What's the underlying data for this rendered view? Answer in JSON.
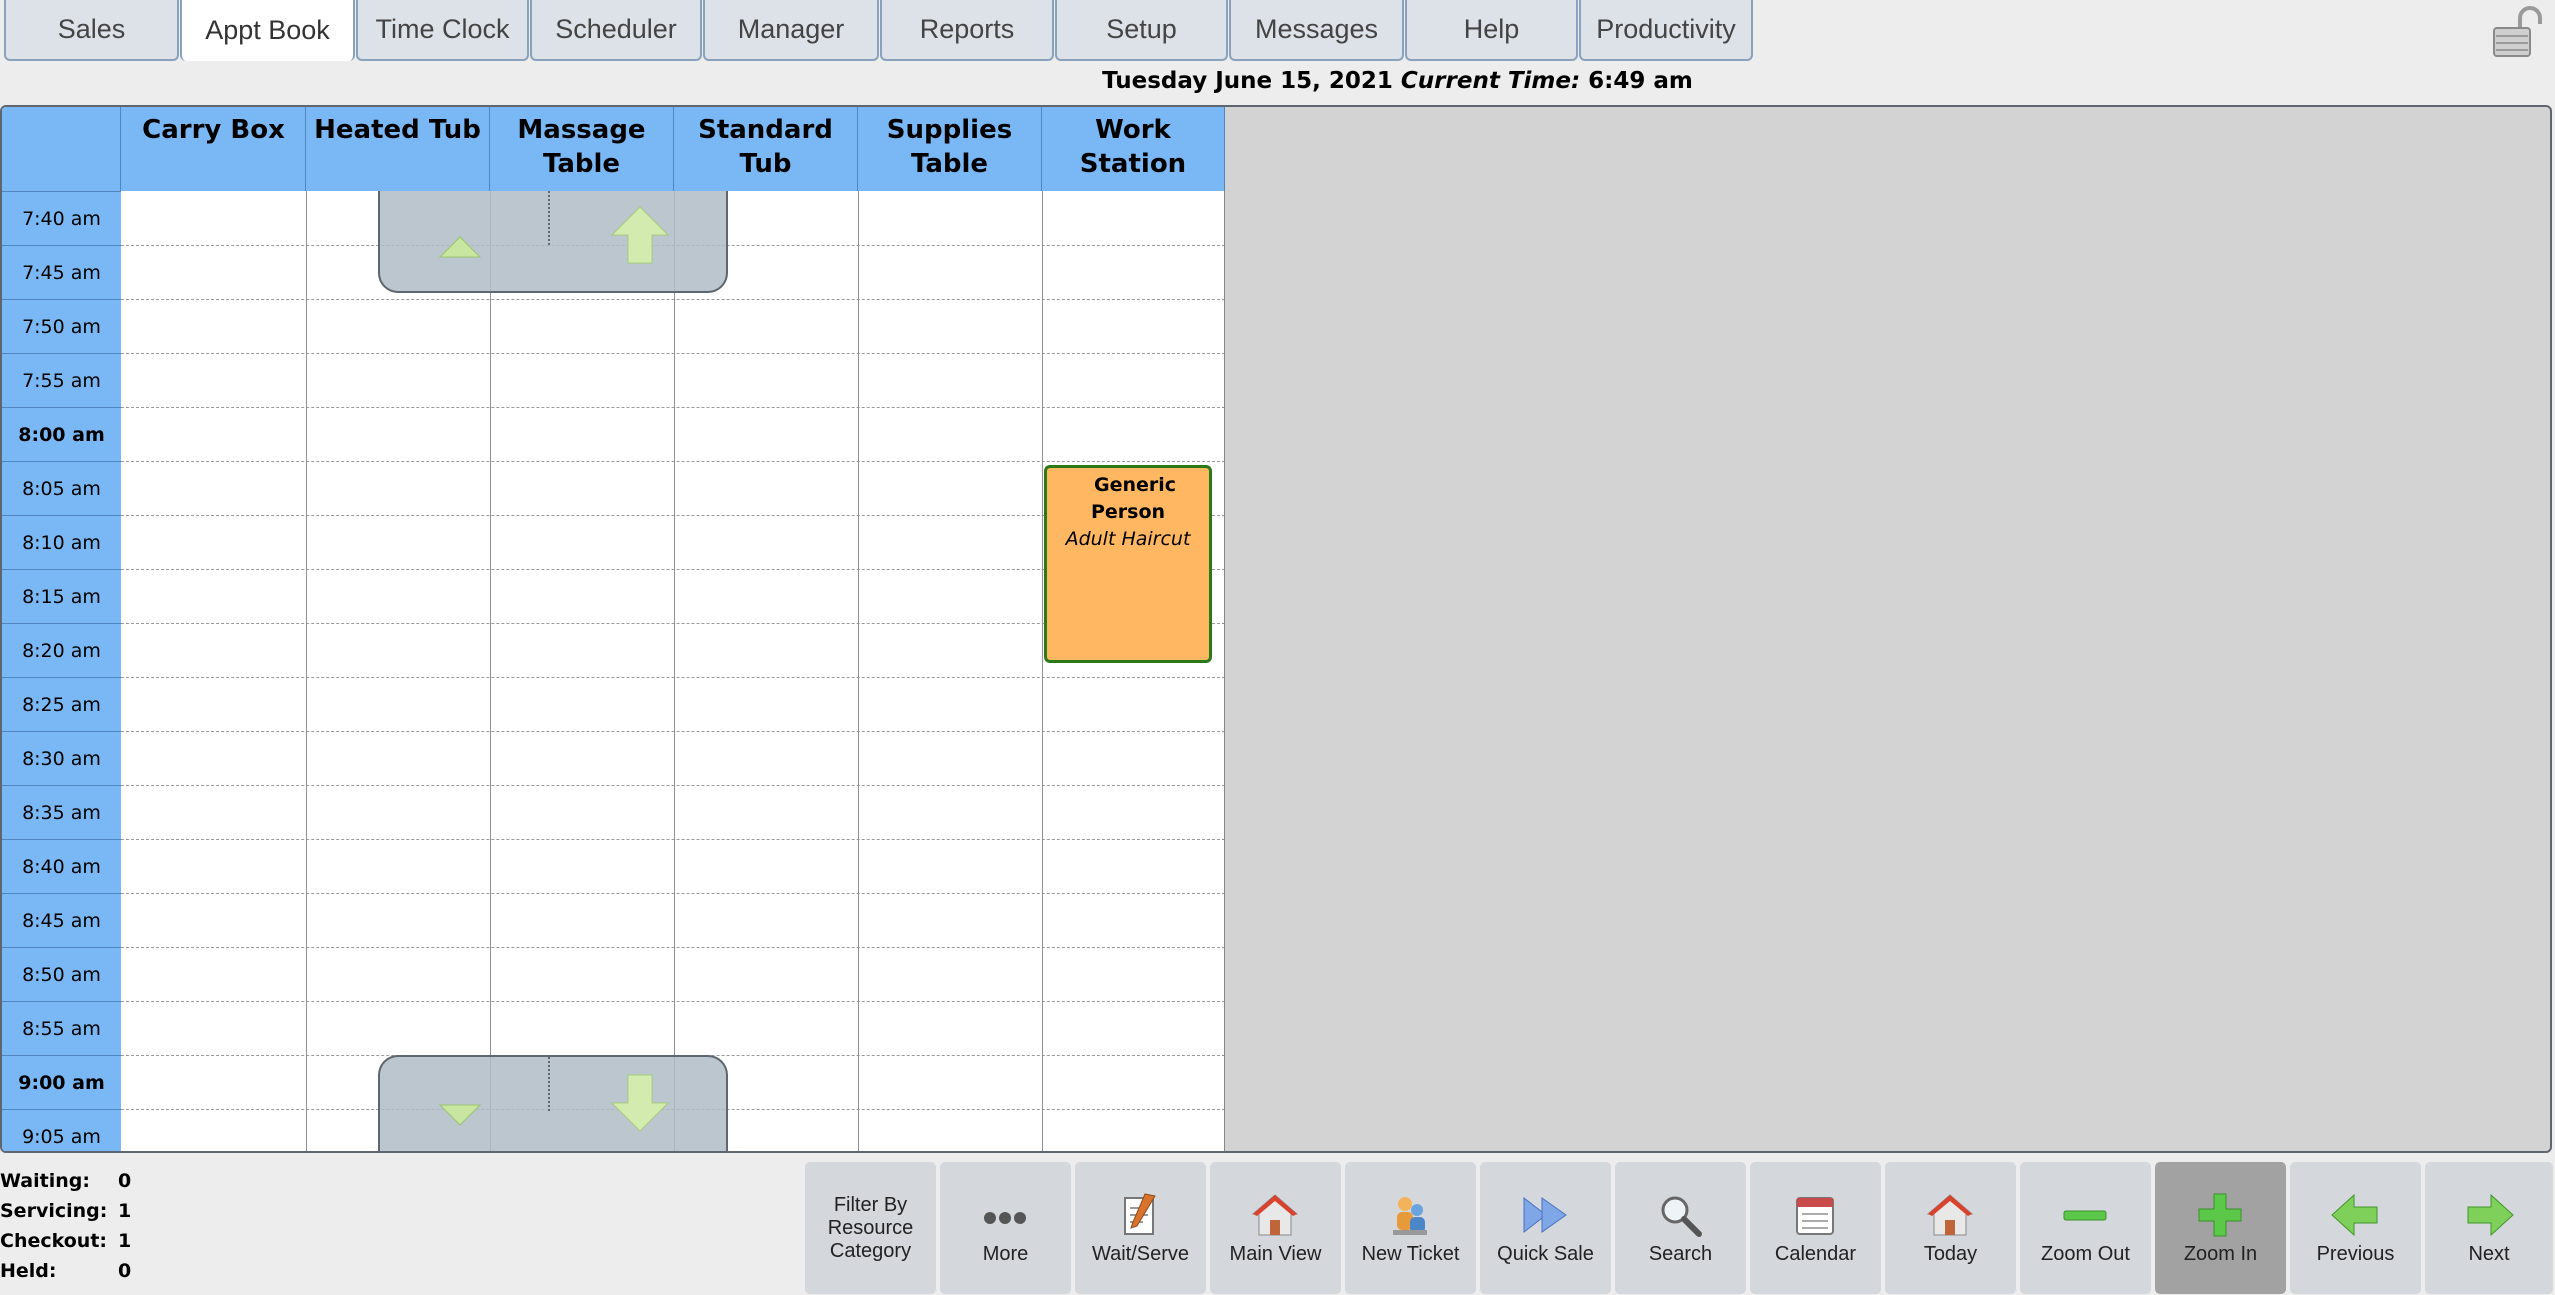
{
  "tabs": [
    {
      "label": "Sales",
      "active": false
    },
    {
      "label": "Appt Book",
      "active": true
    },
    {
      "label": "Time Clock",
      "active": false
    },
    {
      "label": "Scheduler",
      "active": false
    },
    {
      "label": "Manager",
      "active": false
    },
    {
      "label": "Reports",
      "active": false
    },
    {
      "label": "Setup",
      "active": false
    },
    {
      "label": "Messages",
      "active": false
    },
    {
      "label": "Help",
      "active": false
    },
    {
      "label": "Productivity",
      "active": false
    }
  ],
  "header": {
    "date": "Tuesday June 15, 2021",
    "current_time_label": "Current Time:",
    "current_time": "6:49 am"
  },
  "columns": [
    {
      "line1": "Carry Box",
      "line2": ""
    },
    {
      "line1": "Heated Tub",
      "line2": ""
    },
    {
      "line1": "Massage",
      "line2": "Table"
    },
    {
      "line1": "Standard Tub",
      "line2": ""
    },
    {
      "line1": "Supplies",
      "line2": "Table"
    },
    {
      "line1": "Work Station",
      "line2": ""
    }
  ],
  "times": [
    "7:40 am",
    "7:45 am",
    "7:50 am",
    "7:55 am",
    "8:00 am",
    "8:05 am",
    "8:10 am",
    "8:15 am",
    "8:20 am",
    "8:25 am",
    "8:30 am",
    "8:35 am",
    "8:40 am",
    "8:45 am",
    "8:50 am",
    "8:55 am",
    "9:00 am",
    "9:05 am"
  ],
  "appointment": {
    "first": "Generic",
    "last": "Person",
    "service": "Adult Haircut"
  },
  "status": {
    "waiting_label": "Waiting:",
    "waiting": "0",
    "servicing_label": "Servicing:",
    "servicing": "1",
    "checkout_label": "Checkout:",
    "checkout": "1",
    "held_label": "Held:",
    "held": "0"
  },
  "toolbar": {
    "filter": [
      "Filter By",
      "Resource",
      "Category"
    ],
    "more": "More",
    "wait_serve": "Wait/Serve",
    "main_view": "Main View",
    "new_ticket": "New Ticket",
    "quick_sale": "Quick Sale",
    "search": "Search",
    "calendar": "Calendar",
    "today": "Today",
    "zoom_out": "Zoom Out",
    "zoom_in": "Zoom In",
    "previous": "Previous",
    "next": "Next"
  },
  "colors": {
    "header_blue": "#7ab8f5",
    "appointment_fill": "#ffb861",
    "appointment_border": "#2a7a1a"
  }
}
